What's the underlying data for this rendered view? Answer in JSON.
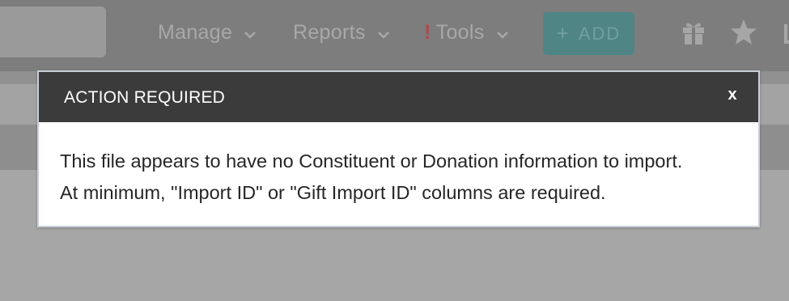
{
  "nav": {
    "manage_label": "Manage",
    "reports_label": "Reports",
    "tools_alert": "!",
    "tools_label": "Tools",
    "add_plus": "+",
    "add_label": "ADD",
    "icons": [
      "gift-icon",
      "star-icon"
    ]
  },
  "modal": {
    "title": "ACTION REQUIRED",
    "close_label": "x",
    "message_line1": "This file appears to have no Constituent or Donation information to import.",
    "message_line2": "At minimum, \"Import ID\" or \"Gift Import ID\" columns are required."
  }
}
